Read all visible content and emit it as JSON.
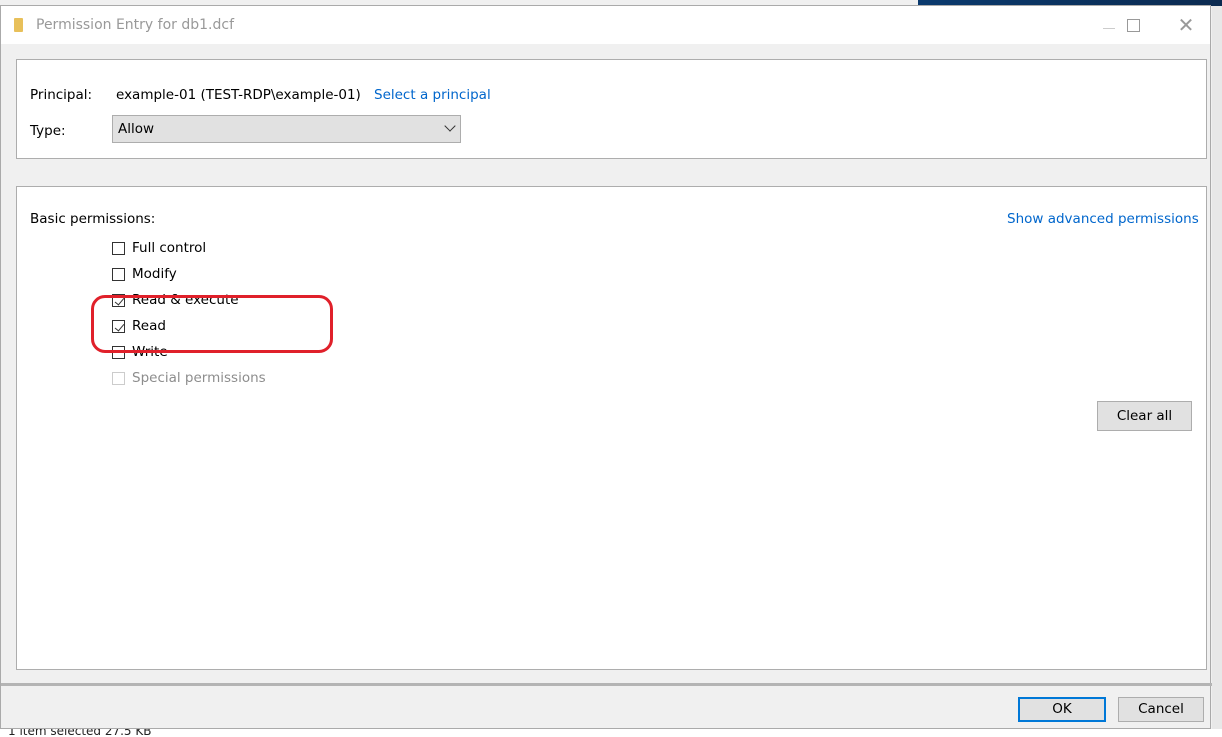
{
  "window": {
    "title": "Permission Entry for db1.dcf"
  },
  "principal": {
    "label": "Principal:",
    "value": "example-01 (TEST-RDP\\example-01)",
    "select_link": "Select a principal"
  },
  "type": {
    "label": "Type:",
    "value": "Allow"
  },
  "permissions": {
    "label": "Basic permissions:",
    "advanced_link": "Show advanced permissions",
    "items": [
      {
        "label": "Full control",
        "checked": false,
        "disabled": false
      },
      {
        "label": "Modify",
        "checked": false,
        "disabled": false
      },
      {
        "label": "Read & execute",
        "checked": true,
        "disabled": false
      },
      {
        "label": "Read",
        "checked": true,
        "disabled": false
      },
      {
        "label": "Write",
        "checked": false,
        "disabled": false
      },
      {
        "label": "Special permissions",
        "checked": false,
        "disabled": true
      }
    ],
    "clear_all": "Clear all"
  },
  "buttons": {
    "ok": "OK",
    "cancel": "Cancel"
  },
  "background": {
    "status_text": "1 item selected  27.5 KB"
  },
  "colors": {
    "link": "#0066cc",
    "highlight": "#e0202a",
    "default_button_border": "#0078d7"
  }
}
